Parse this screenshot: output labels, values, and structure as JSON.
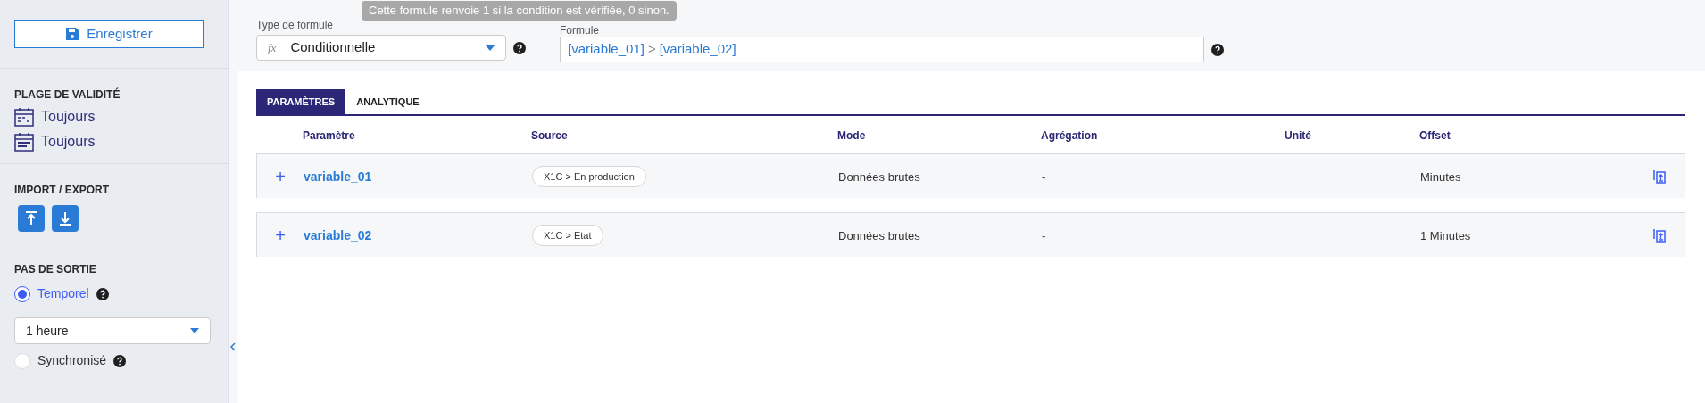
{
  "sidebar": {
    "save_button": "Enregistrer",
    "sections": [
      {
        "kind": "validity",
        "title": "PLAGE DE VALIDITÉ",
        "items": [
          "Toujours",
          "Toujours"
        ]
      },
      {
        "kind": "import_export",
        "title": "IMPORT / EXPORT"
      },
      {
        "kind": "output",
        "title": "PAS DE SORTIE",
        "options": [
          {
            "label": "Temporel",
            "selected": true
          },
          {
            "label": "Synchronisé",
            "selected": false
          }
        ],
        "select_value": "1 heure"
      }
    ]
  },
  "formula": {
    "type_label": "Type de formule",
    "type_value": "Conditionnelle",
    "fx": "fx",
    "tooltip": "Cette formule renvoie 1 si la condition est vérifiée, 0 sinon.",
    "formula_label": "Formule",
    "formula_tokens": [
      {
        "kind": "var",
        "text": "[variable_01]"
      },
      {
        "kind": "op",
        "text": ">"
      },
      {
        "kind": "var",
        "text": "[variable_02]"
      }
    ]
  },
  "tabs": [
    {
      "label": "PARAMÈTRES",
      "selected": true
    },
    {
      "label": "ANALYTIQUE",
      "selected": false
    }
  ],
  "table": {
    "columns": [
      "Paramètre",
      "Source",
      "Mode",
      "Agrégation",
      "Unité",
      "Offset"
    ],
    "rows": [
      {
        "expander": "+",
        "name": "variable_01",
        "source": "X1C > En production",
        "mode": "Données brutes",
        "aggregation": "-",
        "unit": "",
        "offset": "Minutes"
      },
      {
        "expander": "+",
        "name": "variable_02",
        "source": "X1C > Etat",
        "mode": "Données brutes",
        "aggregation": "-",
        "unit": "",
        "offset": "1 Minutes"
      }
    ]
  }
}
